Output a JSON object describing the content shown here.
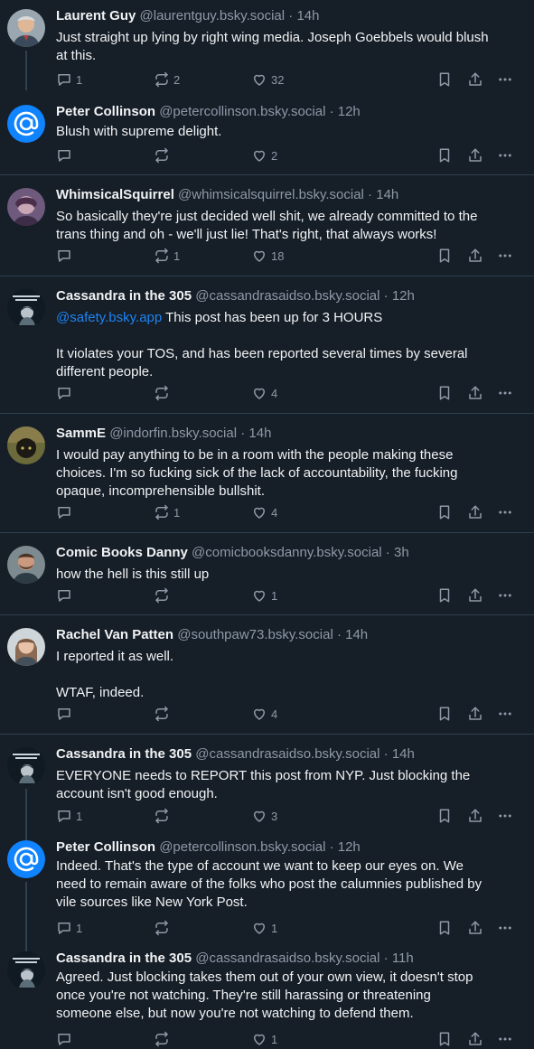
{
  "posts": [
    {
      "author": "Laurent Guy",
      "handle": "@laurentguy.bsky.social",
      "time": "14h",
      "avatar": "photo-man-gray-hair",
      "lines": [
        "Just straight up lying by right wing media. Joseph Goebbels would blush",
        "at this."
      ],
      "replies": "1",
      "reposts": "2",
      "likes": "32"
    },
    {
      "author": "Peter Collinson",
      "handle": "@petercollinson.bsky.social",
      "time": "12h",
      "avatar": "default-at-avatar",
      "lines": [
        "Blush with supreme delight."
      ],
      "replies": "",
      "reposts": "",
      "likes": "2"
    },
    {
      "author": "WhimsicalSquirrel",
      "handle": "@whimsicalsquirrel.bsky.social",
      "time": "14h",
      "avatar": "photo-person-purple",
      "lines": [
        "So basically they're just decided well shit, we already committed to the",
        "trans thing and oh - we'll just lie! That's right, that always works!"
      ],
      "replies": "",
      "reposts": "1",
      "likes": "18"
    },
    {
      "author": "Cassandra in the 305",
      "handle": "@cassandrasaidso.bsky.social",
      "time": "12h",
      "avatar": "illustration-dark",
      "mention": "@safety.bsky.app",
      "lines": [
        " This post has been up for 3 HOURS",
        "",
        "It violates your TOS, and has been reported several times by several",
        "different people."
      ],
      "replies": "",
      "reposts": "",
      "likes": "4"
    },
    {
      "author": "SammE",
      "handle": "@indorfin.bsky.social",
      "time": "14h",
      "avatar": "photo-cat-dark",
      "lines": [
        "I would pay anything to be in a room with the people making these",
        "choices. I'm so fucking sick of the lack of accountability, the fucking",
        "opaque, incomprehensible bullshit."
      ],
      "replies": "",
      "reposts": "1",
      "likes": "4"
    },
    {
      "author": "Comic Books Danny",
      "handle": "@comicbooksdanny.bsky.social",
      "time": "3h",
      "avatar": "photo-man-beard",
      "lines": [
        "how the hell is this still up"
      ],
      "replies": "",
      "reposts": "",
      "likes": "1"
    },
    {
      "author": "Rachel Van Patten",
      "handle": "@southpaw73.bsky.social",
      "time": "14h",
      "avatar": "photo-woman-light",
      "lines": [
        "I reported it as well.",
        "",
        "WTAF, indeed."
      ],
      "replies": "",
      "reposts": "",
      "likes": "4"
    },
    {
      "author": "Cassandra in the 305",
      "handle": "@cassandrasaidso.bsky.social",
      "time": "14h",
      "avatar": "illustration-dark",
      "lines": [
        "EVERYONE needs to REPORT this post from NYP. Just blocking the",
        "account isn't good enough."
      ],
      "replies": "1",
      "reposts": "",
      "likes": "3"
    },
    {
      "author": "Peter Collinson",
      "handle": "@petercollinson.bsky.social",
      "time": "12h",
      "avatar": "default-at-avatar",
      "lines": [
        "Indeed.  That's the type of account we want to keep our eyes on.  We",
        "need to remain aware of the folks who post the calumnies published by",
        "vile sources like New York Post."
      ],
      "replies": "1",
      "reposts": "",
      "likes": "1"
    },
    {
      "author": "Cassandra in the 305",
      "handle": "@cassandrasaidso.bsky.social",
      "time": "11h",
      "avatar": "illustration-dark",
      "lines": [
        "Agreed. Just blocking takes them out of your own view, it doesn't stop",
        "once you're not watching. They're still harassing or threatening",
        "someone else, but now you're not watching to defend them."
      ],
      "replies": "",
      "reposts": "",
      "likes": "1"
    }
  ],
  "colors": {
    "background": "#161e27",
    "text": "#f1f3f5",
    "muted": "#8d9aa8",
    "link": "#1d84f5",
    "separator": "#2e4052"
  }
}
